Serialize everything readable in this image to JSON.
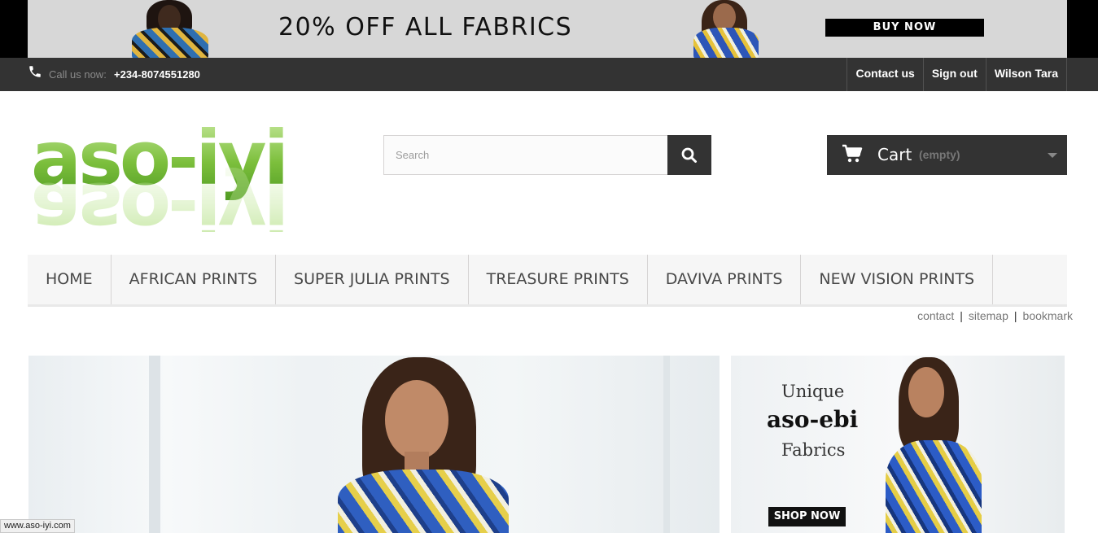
{
  "promo": {
    "text": "20% OFF ALL FABRICS",
    "button_label": "BUY NOW",
    "background": "#d7d7d7"
  },
  "topnav": {
    "phone_icon": "phone-icon",
    "call_label": "Call us now:",
    "call_number": "+234-8074551280",
    "links": [
      "Contact us",
      "Sign out",
      "Wilson Tara"
    ]
  },
  "header": {
    "logo_text": "aso-iyi",
    "logo_color": "#7cbf3c",
    "search": {
      "placeholder": "Search",
      "button_icon": "search-icon"
    },
    "cart": {
      "title": "Cart",
      "quantity": "(empty)",
      "icon": "shopping-cart-icon"
    }
  },
  "menu": {
    "items": [
      "HOME",
      "AFRICAN PRINTS",
      "SUPER JULIA PRINTS",
      "TREASURE PRINTS",
      "DAVIVA PRINTS",
      "NEW VISION PRINTS"
    ]
  },
  "sublinks": [
    "contact",
    "sitemap",
    "bookmark"
  ],
  "side_banner": {
    "line1": "Unique",
    "line2": "aso-ebi",
    "line3": "Fabrics",
    "button_label": "SHOP NOW"
  },
  "status_bar": {
    "url": "www.aso-iyi.com"
  },
  "colors": {
    "dark": "#333333",
    "menu_bg": "#f6f6f6",
    "accent_green": "#7cbf3c"
  }
}
